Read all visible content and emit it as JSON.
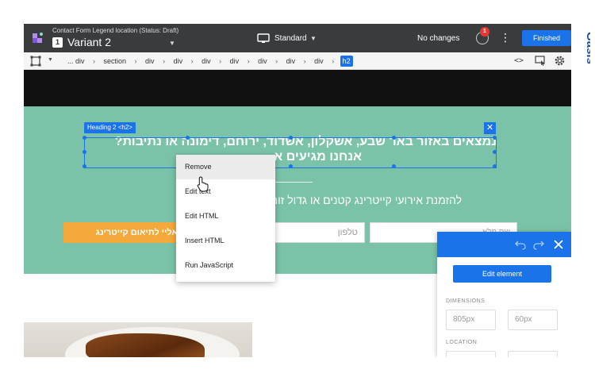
{
  "topbar": {
    "subtitle": "Contact Form Legend location (Status: Draft)",
    "variant_number": "1",
    "variant_name": "Variant 2",
    "device_label": "Standard",
    "changes_label": "No changes",
    "notification_count": "1",
    "finished_label": "Finished"
  },
  "breadcrumb": {
    "items": [
      "... div",
      "section",
      "div",
      "div",
      "div",
      "div",
      "div",
      "div",
      "div",
      "h2"
    ],
    "code_label": "<>"
  },
  "canvas": {
    "heading_line1": "נמצאים באזור באר שבע, אשקלון, אשדוד, ירוחם, דימונה או נתיבות?",
    "heading_line2": "אנחנו מגיעים א",
    "selection_tag": "Heading 2 <h2>",
    "selection_close": "✕",
    "subheading": "להזמנת אירועי קייטרינג קטנים או גדול         זור אליכם:",
    "cta_button": "אליי לתיאום קייטרינג",
    "phone_placeholder": "טלפון",
    "name_placeholder": "שם מלא"
  },
  "context_menu": {
    "items": [
      "Remove",
      "Edit text",
      "Edit HTML",
      "Insert HTML",
      "Run JavaScript"
    ]
  },
  "side_panel": {
    "edit_button": "Edit element",
    "dimensions_label": "DIMENSIONS",
    "width_value": "805px",
    "height_value": "60px",
    "location_label": "LOCATION"
  },
  "brand": {
    "name": "Gasis"
  },
  "colors": {
    "accent": "#1a73e8",
    "topbar": "#3a3b3d",
    "hero": "#7bc3a8",
    "cta": "#f4a93a"
  }
}
